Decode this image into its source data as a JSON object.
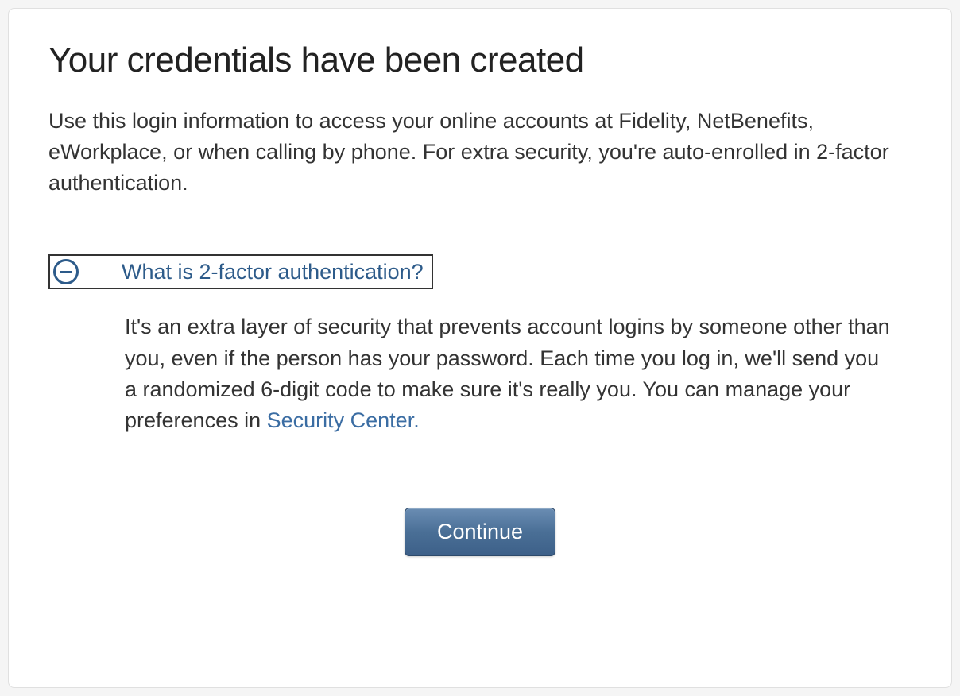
{
  "title": "Your credentials have been created",
  "intro": "Use this login information to access your online accounts at Fidelity, NetBenefits, eWorkplace, or when calling by phone. For extra security, you're auto-enrolled in 2-factor authentication.",
  "accordion": {
    "title": "What is 2-factor authentication?",
    "body": "It's an extra layer of security that prevents account logins by someone other than you, even if the person has your password. Each time you log in, we'll send you a randomized 6-digit code to make sure it's really you. You can manage your preferences in ",
    "link_text": "Security Center."
  },
  "continue_label": "Continue"
}
